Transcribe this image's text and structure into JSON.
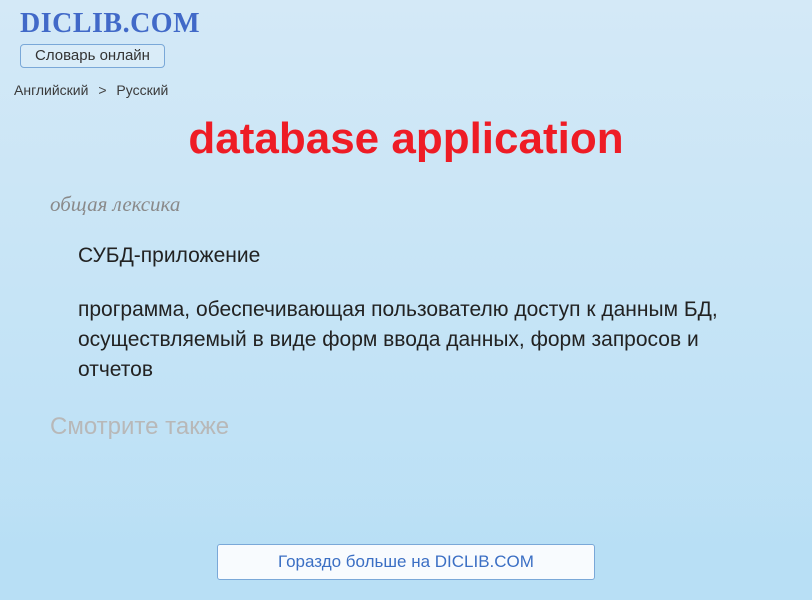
{
  "header": {
    "logo": "DICLIB.COM",
    "subtitle": "Словарь онлайн"
  },
  "breadcrumb": {
    "from": "Английский",
    "sep": ">",
    "to": "Русский"
  },
  "title": "database application",
  "entry": {
    "category": "общая лексика",
    "definition": "СУБД-приложение",
    "description": "программа, обеспечивающая пользователю доступ к данным БД, осуществляемый в виде форм ввода данных, форм запросов и отчетов",
    "see_also": "Смотрите также"
  },
  "cta": {
    "label": "Гораздо больше на DICLIB.COM"
  }
}
